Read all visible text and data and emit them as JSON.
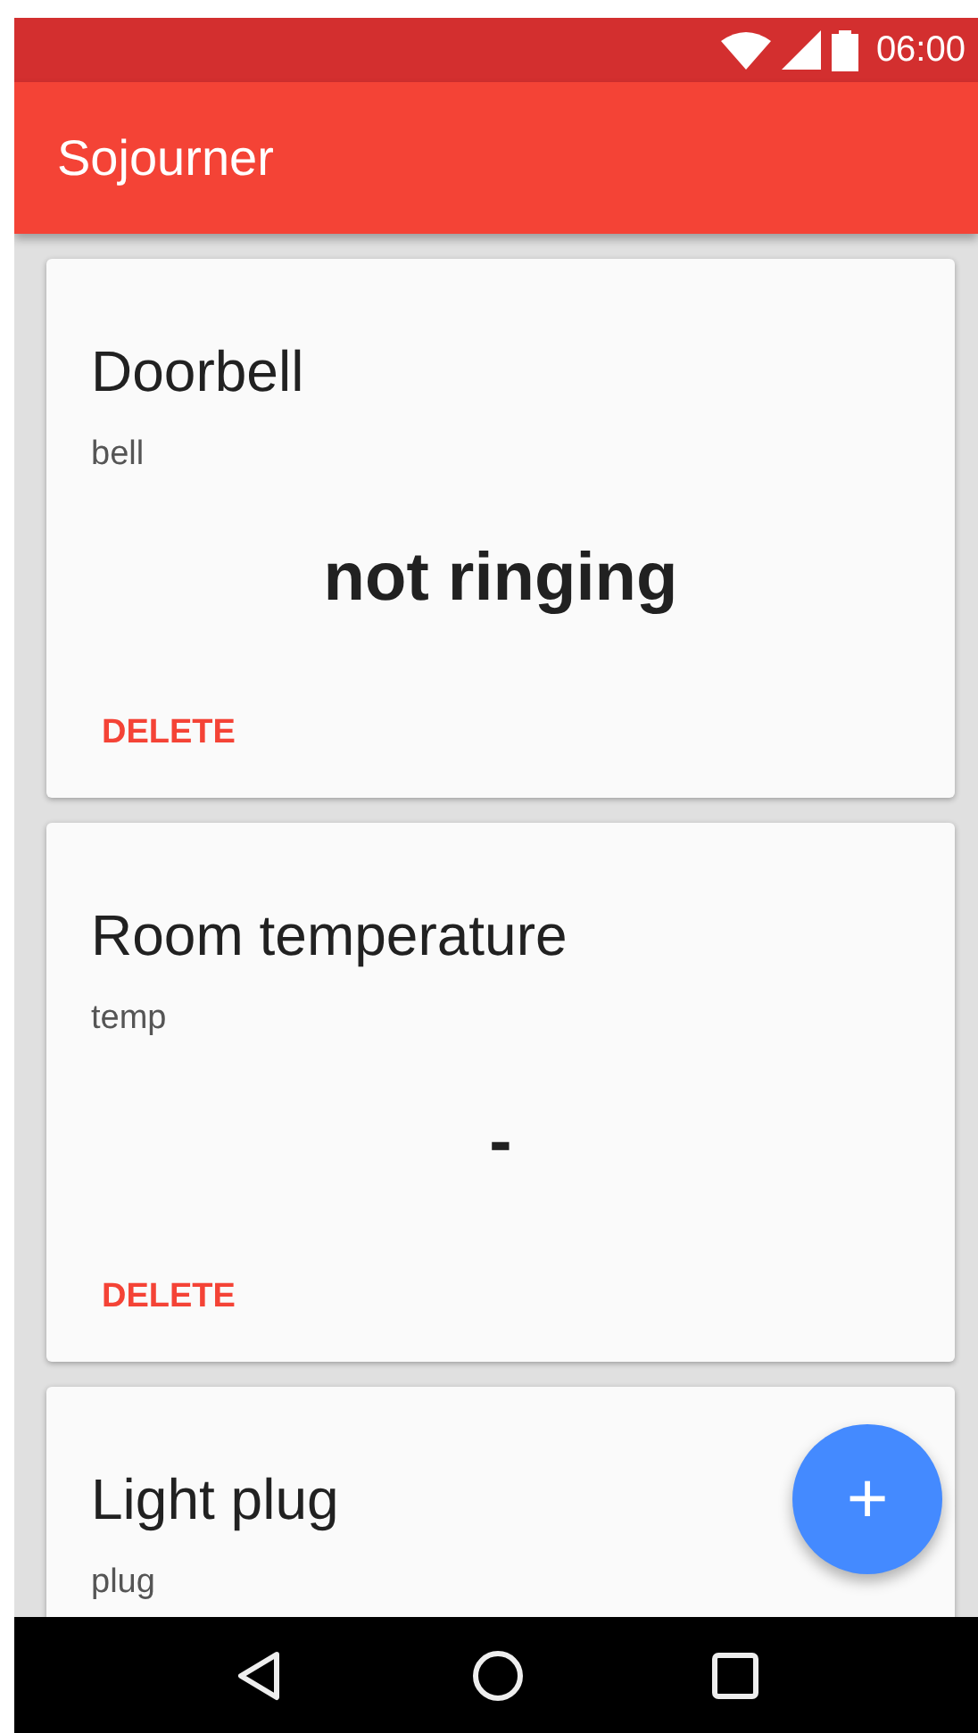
{
  "status_bar": {
    "time": "06:00"
  },
  "app_bar": {
    "title": "Sojourner"
  },
  "cards": [
    {
      "title": "Doorbell",
      "subtitle": "bell",
      "value": "not ringing",
      "action": "DELETE"
    },
    {
      "title": "Room temperature",
      "subtitle": "temp",
      "value": "-",
      "action": "DELETE"
    },
    {
      "title": "Light plug",
      "subtitle": "plug"
    }
  ],
  "fab": {
    "label": "+"
  }
}
